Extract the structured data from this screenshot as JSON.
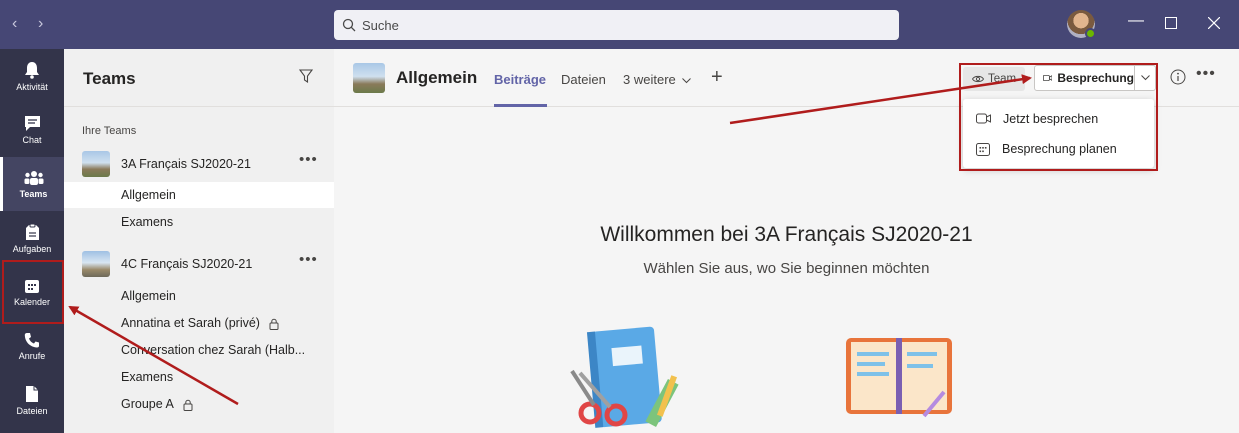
{
  "titlebar": {
    "search_placeholder": "Suche"
  },
  "rail": {
    "items": [
      {
        "label": "Aktivität",
        "icon": "bell-icon"
      },
      {
        "label": "Chat",
        "icon": "chat-icon"
      },
      {
        "label": "Teams",
        "icon": "teams-icon"
      },
      {
        "label": "Aufgaben",
        "icon": "assignments-icon"
      },
      {
        "label": "Kalender",
        "icon": "calendar-icon"
      },
      {
        "label": "Anrufe",
        "icon": "phone-icon"
      },
      {
        "label": "Dateien",
        "icon": "files-icon"
      }
    ]
  },
  "teams_pane": {
    "title": "Teams",
    "section_label": "Ihre Teams",
    "teams": [
      {
        "name": "3A Français SJ2020-21",
        "channels": [
          "Allgemein",
          "Examens"
        ]
      },
      {
        "name": "4C Français SJ2020-21",
        "channels": [
          "Allgemein",
          "Annatina et Sarah (privé)",
          "Conversation chez Sarah (Halb...",
          "Examens",
          "Groupe A"
        ]
      }
    ]
  },
  "main": {
    "channel_title": "Allgemein",
    "tabs": [
      "Beiträge",
      "Dateien",
      "3 weitere"
    ],
    "team_button": "Team",
    "meeting_button": "Besprechung",
    "dropdown": [
      "Jetzt besprechen",
      "Besprechung planen"
    ],
    "welcome_title": "Willkommen bei 3A Français SJ2020-21",
    "welcome_sub": "Wählen Sie aus, wo Sie beginnen möchten"
  },
  "colors": {
    "titlebar": "#464775",
    "rail": "#33344a",
    "accent": "#6264a7",
    "annotation": "#b01c1c"
  }
}
